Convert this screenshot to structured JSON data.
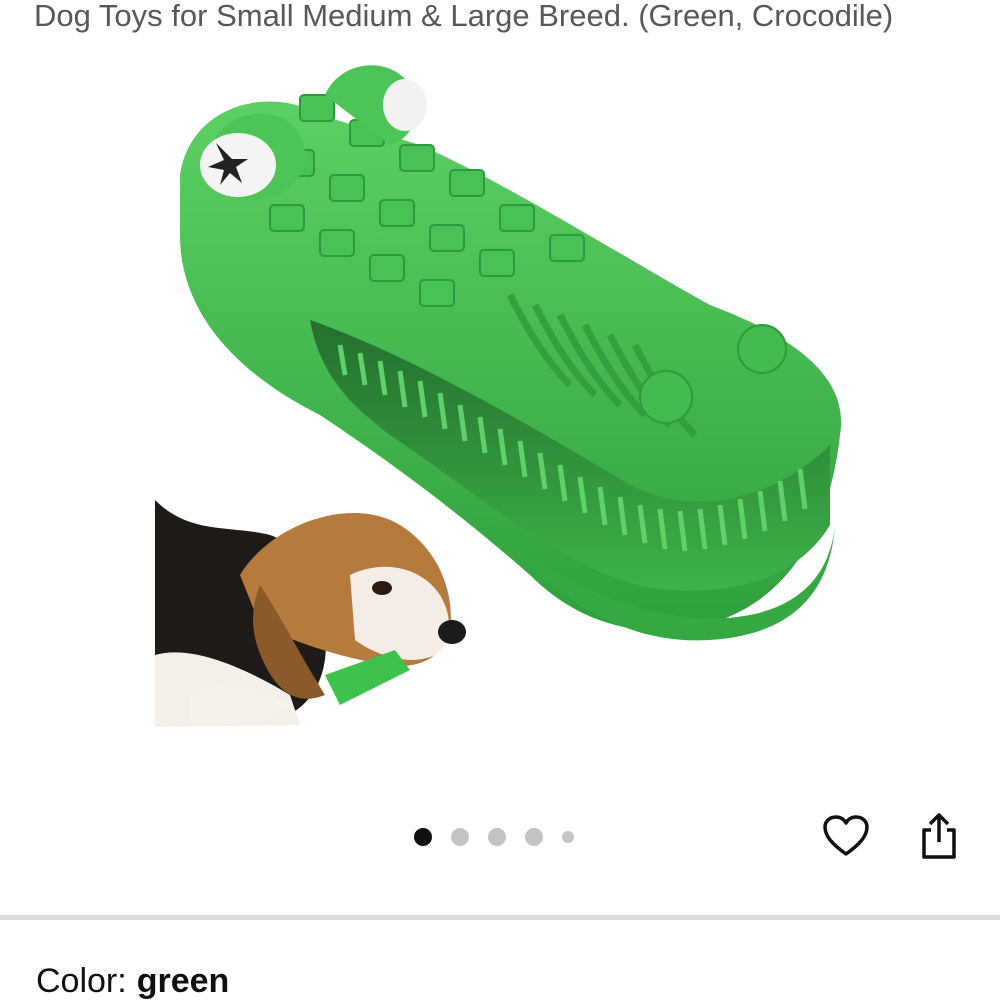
{
  "product": {
    "title": "Dog Toys for Small Medium & Large Breed. (Green, Crocodile)"
  },
  "gallery": {
    "image_name": "green crocodile chew toy with beagle puppy",
    "active_index": 1,
    "total_dots": 5
  },
  "actions": {
    "favorite_icon": "heart-icon",
    "share_icon": "share-icon"
  },
  "variation": {
    "label": "Color:",
    "value": "green"
  },
  "colors": {
    "toy_green": "#3cb54a",
    "toy_dark": "#2c9a3b",
    "text": "#0f1111",
    "muted": "#565959"
  }
}
